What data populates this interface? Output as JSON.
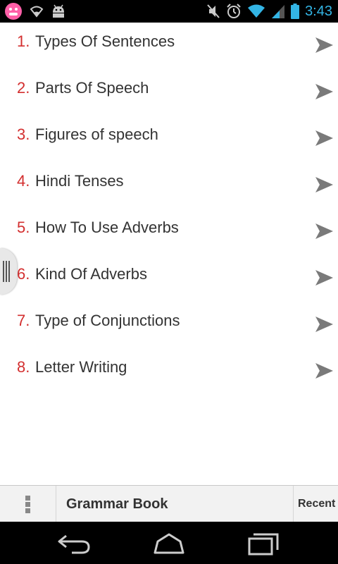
{
  "status_bar": {
    "time": "3:43",
    "left_icons": [
      "app-face-icon",
      "wifi-icon",
      "android-icon"
    ],
    "right_icons": [
      "mute-icon",
      "alarm-icon",
      "wifi-icon",
      "signal-icon",
      "battery-icon"
    ],
    "accent": "#33b5e5"
  },
  "topics": [
    {
      "number": "1.",
      "label": "Types Of Sentences"
    },
    {
      "number": "2.",
      "label": "Parts Of Speech"
    },
    {
      "number": "3.",
      "label": "Figures of speech"
    },
    {
      "number": "4.",
      "label": "Hindi Tenses"
    },
    {
      "number": "5.",
      "label": "How To Use Adverbs"
    },
    {
      "number": "6.",
      "label": "Kind Of Adverbs"
    },
    {
      "number": "7.",
      "label": "Type of Conjunctions"
    },
    {
      "number": "8.",
      "label": "Letter Writing"
    }
  ],
  "colors": {
    "number": "#d32f2f",
    "label": "#333333",
    "arrow": "#7a7a7a"
  },
  "action_bar": {
    "title": "Grammar Book",
    "recent_label": "Recent"
  },
  "nav_bar": {
    "icons": [
      "back-icon",
      "home-icon",
      "recent-apps-icon"
    ]
  }
}
